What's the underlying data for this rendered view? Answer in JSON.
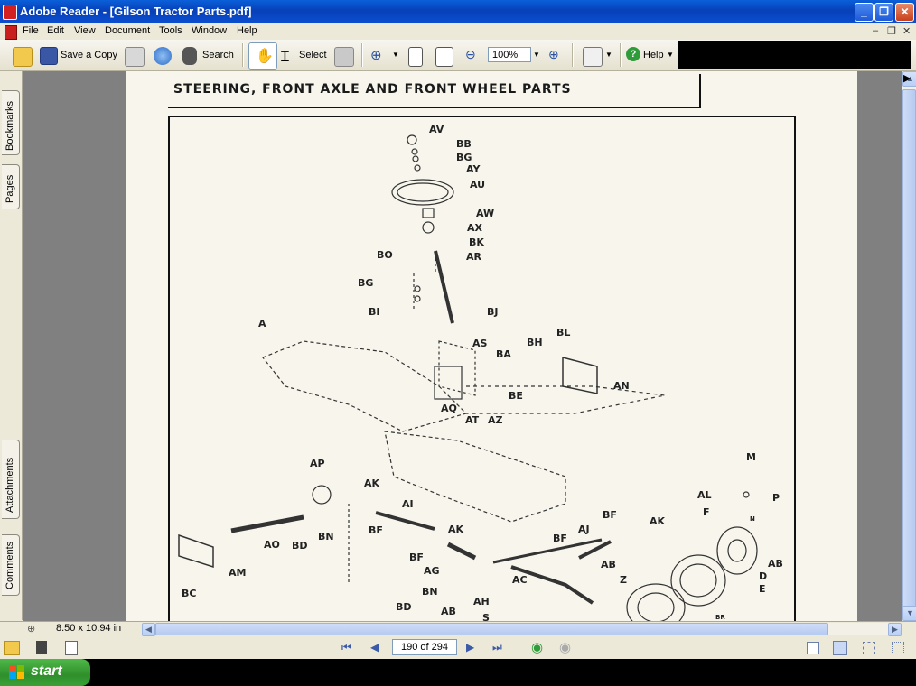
{
  "window": {
    "title": "Adobe Reader - [Gilson Tractor Parts.pdf]"
  },
  "menu": {
    "items": [
      "File",
      "Edit",
      "View",
      "Document",
      "Tools",
      "Window",
      "Help"
    ]
  },
  "toolbar": {
    "save_copy": "Save a Copy",
    "search": "Search",
    "select": "Select",
    "zoom_value": "100%",
    "help": "Help"
  },
  "navpanel": {
    "tabs": [
      "Bookmarks",
      "Pages",
      "Attachments",
      "Comments"
    ]
  },
  "document": {
    "page_title": "STEERING, FRONT AXLE AND FRONT WHEEL PARTS",
    "part_labels": [
      {
        "id": "lbl-av",
        "text": "AV"
      },
      {
        "id": "lbl-bb",
        "text": "BB"
      },
      {
        "id": "lbl-bg1",
        "text": "BG"
      },
      {
        "id": "lbl-ay",
        "text": "AY"
      },
      {
        "id": "lbl-au",
        "text": "AU"
      },
      {
        "id": "lbl-aw",
        "text": "AW"
      },
      {
        "id": "lbl-ax",
        "text": "AX"
      },
      {
        "id": "lbl-bk",
        "text": "BK"
      },
      {
        "id": "lbl-bo",
        "text": "BO"
      },
      {
        "id": "lbl-ar",
        "text": "AR"
      },
      {
        "id": "lbl-bg2",
        "text": "BG"
      },
      {
        "id": "lbl-bj",
        "text": "BJ"
      },
      {
        "id": "lbl-bi",
        "text": "BI"
      },
      {
        "id": "lbl-a",
        "text": "A"
      },
      {
        "id": "lbl-as",
        "text": "AS"
      },
      {
        "id": "lbl-bh",
        "text": "BH"
      },
      {
        "id": "lbl-bl",
        "text": "BL"
      },
      {
        "id": "lbl-ba",
        "text": "BA"
      },
      {
        "id": "lbl-an",
        "text": "AN"
      },
      {
        "id": "lbl-be",
        "text": "BE"
      },
      {
        "id": "lbl-aq",
        "text": "AQ"
      },
      {
        "id": "lbl-at",
        "text": "AT"
      },
      {
        "id": "lbl-az",
        "text": "AZ"
      },
      {
        "id": "lbl-m",
        "text": "M"
      },
      {
        "id": "lbl-ap",
        "text": "AP"
      },
      {
        "id": "lbl-ak1",
        "text": "AK"
      },
      {
        "id": "lbl-ai",
        "text": "AI"
      },
      {
        "id": "lbl-al",
        "text": "AL"
      },
      {
        "id": "lbl-p",
        "text": "P"
      },
      {
        "id": "lbl-f",
        "text": "F"
      },
      {
        "id": "lbl-bf1",
        "text": "BF"
      },
      {
        "id": "lbl-ak2",
        "text": "AK"
      },
      {
        "id": "lbl-ao",
        "text": "AO"
      },
      {
        "id": "lbl-bd1",
        "text": "BD"
      },
      {
        "id": "lbl-bn1",
        "text": "BN"
      },
      {
        "id": "lbl-bf2",
        "text": "BF"
      },
      {
        "id": "lbl-aj",
        "text": "AJ"
      },
      {
        "id": "lbl-ak3",
        "text": "AK"
      },
      {
        "id": "lbl-am",
        "text": "AM"
      },
      {
        "id": "lbl-bf3",
        "text": "BF"
      },
      {
        "id": "lbl-bf4",
        "text": "BF"
      },
      {
        "id": "lbl-ab1",
        "text": "AB"
      },
      {
        "id": "lbl-ab2",
        "text": "AB"
      },
      {
        "id": "lbl-ag",
        "text": "AG"
      },
      {
        "id": "lbl-ac",
        "text": "AC"
      },
      {
        "id": "lbl-d",
        "text": "D"
      },
      {
        "id": "lbl-e",
        "text": "E"
      },
      {
        "id": "lbl-bc",
        "text": "BC"
      },
      {
        "id": "lbl-bn2",
        "text": "BN"
      },
      {
        "id": "lbl-z",
        "text": "Z"
      },
      {
        "id": "lbl-ah",
        "text": "AH"
      },
      {
        "id": "lbl-bd2",
        "text": "BD"
      },
      {
        "id": "lbl-ab3",
        "text": "AB"
      },
      {
        "id": "lbl-s",
        "text": "S"
      },
      {
        "id": "lbl-n",
        "text": "N"
      },
      {
        "id": "lbl-br",
        "text": "BR"
      }
    ]
  },
  "status": {
    "page_size": "8.50 x 10.94 in"
  },
  "navigation": {
    "page_display": "190 of 294"
  },
  "taskbar": {
    "start": "start"
  }
}
